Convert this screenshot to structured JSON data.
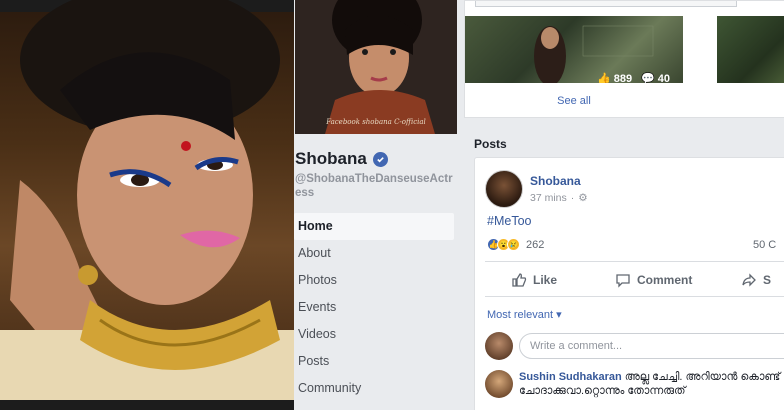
{
  "page": {
    "name": "Shobana",
    "username": "@ShobanaTheDanseuseActress",
    "cover_caption": "Facebook shobana C-official"
  },
  "nav": [
    {
      "label": "Home",
      "active": true
    },
    {
      "label": "About"
    },
    {
      "label": "Photos"
    },
    {
      "label": "Events"
    },
    {
      "label": "Videos"
    },
    {
      "label": "Posts"
    },
    {
      "label": "Community"
    }
  ],
  "photos": {
    "likes": "889",
    "comments": "40",
    "see_all": "See all"
  },
  "posts": {
    "heading": "Posts",
    "post": {
      "author": "Shobana",
      "time": "37 mins",
      "text": "#MeToo",
      "reaction_count": "262",
      "comment_count": "50 C",
      "like_label": "Like",
      "comment_label": "Comment",
      "sort_label": "Most relevant",
      "comment_placeholder": "Write a comment...",
      "reply_author": "Sushin Sudhakaran",
      "reply_text": "അല്ല ചേച്ചി. അറിയാൻ കൊണ്ട് ചോദാക്കുവാ.റ്റൊന്നും തോന്നരുത്"
    }
  },
  "colors": {
    "fb_blue": "#4267b2",
    "link_blue": "#365899",
    "background": "#e9ebee"
  }
}
